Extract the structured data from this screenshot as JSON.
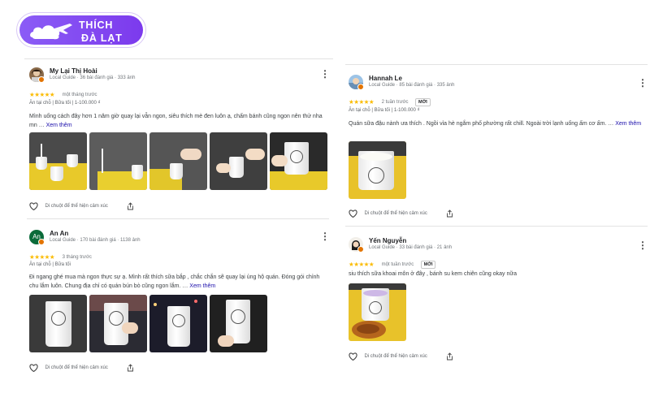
{
  "logo": {
    "line1": "THÍCH",
    "line2": "ĐÀ LẠT"
  },
  "colors": {
    "brand": "#8b5cf6",
    "star": "#fbbc04",
    "link": "#1a0dab",
    "local_guide_badge": "#e37400"
  },
  "reviews": [
    {
      "name": "My Lại Thị Hoài",
      "meta": "Local Guide · 36 bài đánh giá · 333 ảnh",
      "stars": "★★★★★",
      "time": "một tháng trước",
      "tags": "Ăn tại chỗ  |  Bữa tối  |  1-100.000 ₫",
      "text": "Mình uống cách đây hơn 1 năm giờ quay lại vẫn ngon, siêu thích mè đen luôn ạ, chấm bánh cũng ngon nên thử nha mn … ",
      "see_more": "Xem thêm",
      "react": "Di chuột để thể hiện cảm xúc"
    },
    {
      "name": "An An",
      "meta": "Local Guide · 170 bài đánh giá · 1138 ảnh",
      "stars": "★★★★★",
      "time": "3 tháng trước",
      "tags": "Ăn tại chỗ  |  Bữa tối",
      "text": "Đi ngang ghé mua mà ngon thực sự ạ. Mình rất thích sữa bắp , chắc chắn sẽ quay lại ủng hộ quán. Đóng gói chỉnh chu lắm luôn. Chung địa chỉ có quán bún bò cũng ngon lắm. … ",
      "see_more": "Xem thêm",
      "react": "Di chuột để thể hiện cảm xúc"
    },
    {
      "name": "Hannah Le",
      "meta": "Local Guide · 85 bài đánh giá · 335 ảnh",
      "stars": "★★★★★",
      "time": "2 tuần trước",
      "new_badge": "MỚI",
      "tags": "Ăn tại chỗ  |  Bữa tối  |  1-100.000 ₫",
      "text": "Quán sữa đậu nành ưa thích . Ngồi vỉa hè ngắm phố phường rất chill. Ngoài trời lạnh uống ấm cơ ấm. … ",
      "see_more": "Xem thêm",
      "react": "Di chuột để thể hiện cảm xúc"
    },
    {
      "name": "Yến Nguyễn",
      "meta": "Local Guide · 33 bài đánh giá · 21 ảnh",
      "stars": "★★★★★",
      "time": "một tuần trước",
      "new_badge": "MỚI",
      "text": "siu thích sữa khoai môn ở đây , bánh su kem chiên cũng okay nữa",
      "react": "Di chuột để thể hiện cảm xúc"
    }
  ]
}
